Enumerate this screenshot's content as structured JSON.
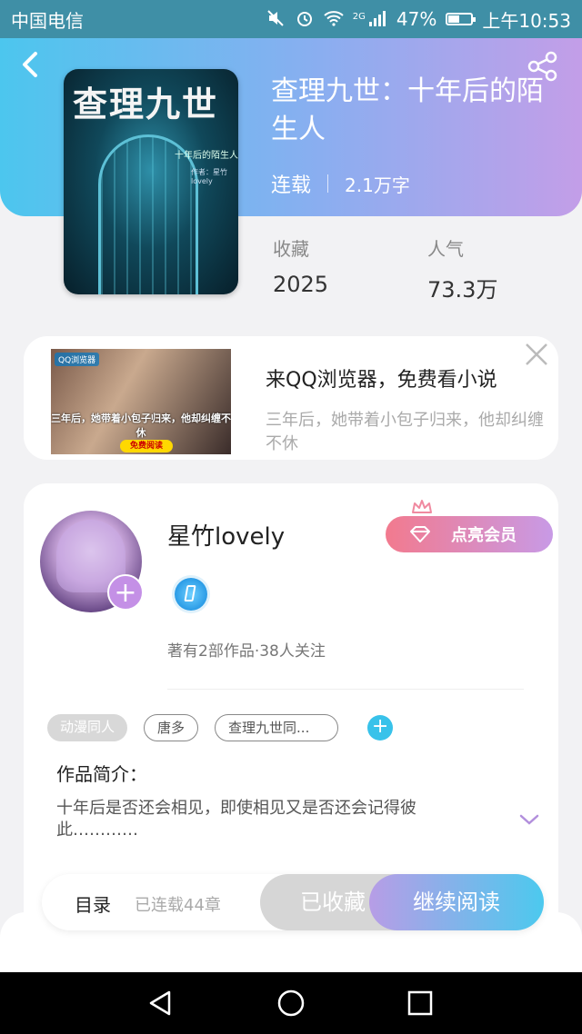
{
  "status_bar": {
    "carrier": "中国电信",
    "network": "2G",
    "battery": "47%",
    "time": "上午10:53",
    "icons": [
      "mute-icon",
      "alarm-icon",
      "wifi-icon",
      "signal-icon",
      "battery-icon"
    ]
  },
  "book": {
    "title": "查理九世：十年后的陌生人",
    "status": "连载",
    "word_count": "2.1万字",
    "cover": {
      "title": "查理九世",
      "subtitle": "十年后的陌生人",
      "author_line": "作者：星竹lovely"
    },
    "stats": [
      {
        "label": "收藏",
        "value": "2025"
      },
      {
        "label": "人气",
        "value": "73.3万"
      }
    ]
  },
  "ad": {
    "image_logo": "QQ浏览器",
    "image_caption": "三年后，她带着小包子归来，他却纠缠不休",
    "image_cta": "免费阅读",
    "title": "来QQ浏览器，免费看小说",
    "description": "三年后，她带着小包子归来，他却纠缠不休"
  },
  "author": {
    "name": "星竹lovely",
    "stats": "著有2部作品·38人关注",
    "vip_button": "点亮会员"
  },
  "tags": [
    {
      "label": "动漫同人",
      "style": "filled"
    },
    {
      "label": "唐多",
      "style": "outline"
    },
    {
      "label": "查理九世同...",
      "style": "outline"
    }
  ],
  "intro": {
    "label": "作品简介：",
    "text": "十年后是否还会相见，即使相见又是否还会记得彼此…………"
  },
  "action_bar": {
    "toc_label": "目录",
    "toc_count": "已连载44章",
    "collected_label": "已收藏",
    "read_label": "继续阅读"
  },
  "colors": {
    "header_gradient": [
      "#4cc6ee",
      "#8aaef0",
      "#c39ee8"
    ],
    "accent_blue": "#38c2ea",
    "accent_purple": "#c490e6",
    "vip_gradient": [
      "#f27a8e",
      "#c89ae6"
    ]
  }
}
